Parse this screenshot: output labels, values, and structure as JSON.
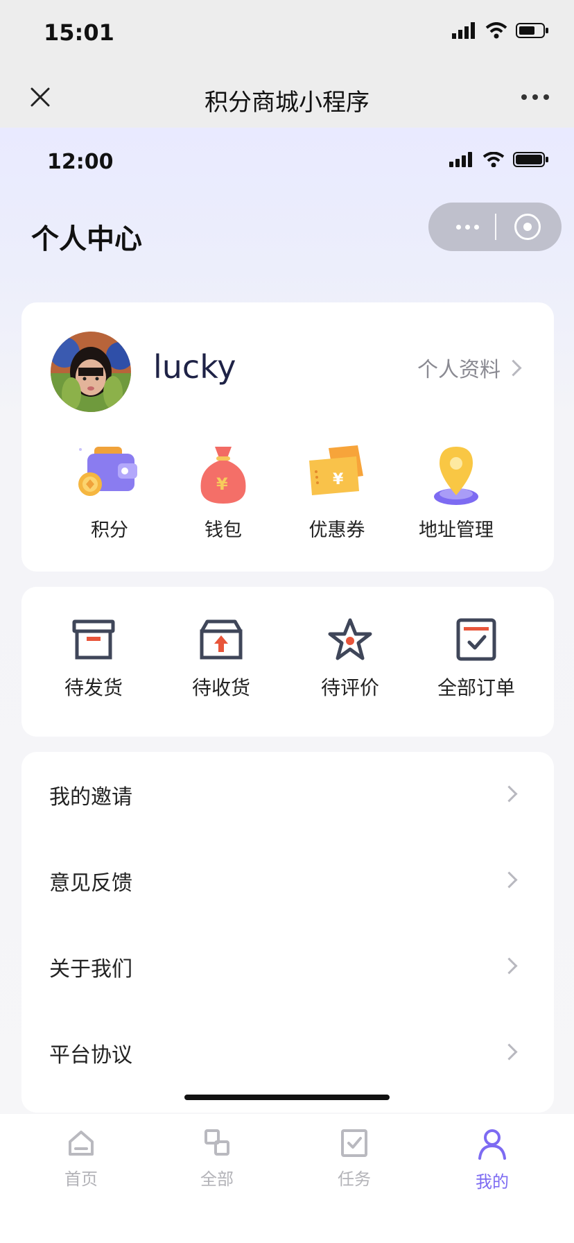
{
  "outer_status": {
    "time": "15:01"
  },
  "outer_nav": {
    "title": "积分商城小程序"
  },
  "inner_status": {
    "time": "12:00"
  },
  "page": {
    "title": "个人中心"
  },
  "profile": {
    "username": "lucky",
    "profile_link": "个人资料"
  },
  "shortcuts": [
    {
      "label": "积分",
      "icon": "wallet-points-icon"
    },
    {
      "label": "钱包",
      "icon": "money-bag-icon"
    },
    {
      "label": "优惠券",
      "icon": "coupon-icon"
    },
    {
      "label": "地址管理",
      "icon": "location-pin-icon"
    }
  ],
  "orders": [
    {
      "label": "待发货",
      "icon": "box-icon"
    },
    {
      "label": "待收货",
      "icon": "box-upload-icon"
    },
    {
      "label": "待评价",
      "icon": "star-icon"
    },
    {
      "label": "全部订单",
      "icon": "order-list-icon"
    }
  ],
  "menu": [
    {
      "label": "我的邀请"
    },
    {
      "label": "意见反馈"
    },
    {
      "label": "关于我们"
    },
    {
      "label": "平台协议"
    }
  ],
  "tabbar": [
    {
      "label": "首页",
      "icon": "home-icon"
    },
    {
      "label": "全部",
      "icon": "categories-icon"
    },
    {
      "label": "任务",
      "icon": "task-check-icon"
    },
    {
      "label": "我的",
      "icon": "user-icon",
      "active": true
    }
  ],
  "colors": {
    "accent": "#7d6bf2",
    "order_icon": "#3f4659",
    "order_accent": "#e8553a"
  }
}
